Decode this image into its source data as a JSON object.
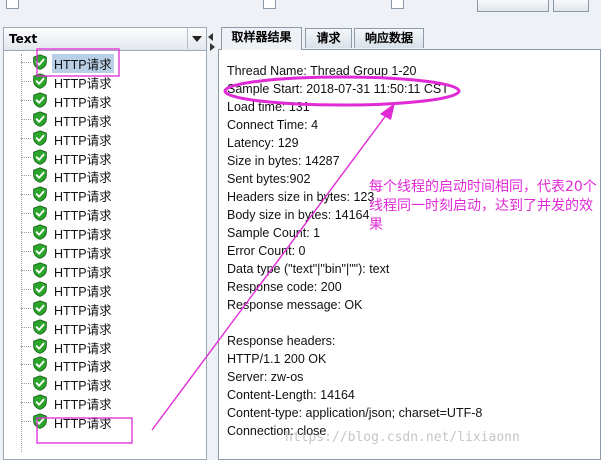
{
  "tree_header": {
    "filter_text": "Text"
  },
  "tree": {
    "items": [
      "HTTP请求",
      "HTTP请求",
      "HTTP请求",
      "HTTP请求",
      "HTTP请求",
      "HTTP请求",
      "HTTP请求",
      "HTTP请求",
      "HTTP请求",
      "HTTP请求",
      "HTTP请求",
      "HTTP请求",
      "HTTP请求",
      "HTTP请求",
      "HTTP请求",
      "HTTP请求",
      "HTTP请求",
      "HTTP请求",
      "HTTP请求",
      "HTTP请求"
    ],
    "selected_index": 0,
    "status_icon": "green-shield-check-icon"
  },
  "tabs": [
    "取样器结果",
    "请求",
    "响应数据"
  ],
  "active_tab": 0,
  "sampler_result": {
    "lines": [
      "Thread Name: Thread Group 1-20",
      "Sample Start: 2018-07-31 11:50:11 CST",
      "Load time: 131",
      "Connect Time: 4",
      "Latency: 129",
      "Size in bytes: 14287",
      "Sent bytes:902",
      "Headers size in bytes: 123",
      "Body size in bytes: 14164",
      "Sample Count: 1",
      "Error Count: 0",
      "Data type (\"text\"|\"bin\"|\"\"): text",
      "Response code: 200",
      "Response message: OK",
      "",
      "Response headers:",
      "HTTP/1.1 200 OK",
      "Server: zw-os",
      "Content-Length: 14164",
      "Content-type: application/json; charset=UTF-8",
      "Connection: close"
    ]
  },
  "annotation": {
    "text": "每个线程的启动时间相同，代表20个线程同一时刻启动，达到了并发的效果",
    "color": "#e02ad6"
  },
  "watermark": "https://blog.csdn.net/lixiaonn",
  "colors": {
    "selection": "#b8cfe5",
    "shield": "#2aa52a",
    "annotation": "#e02ad6"
  }
}
